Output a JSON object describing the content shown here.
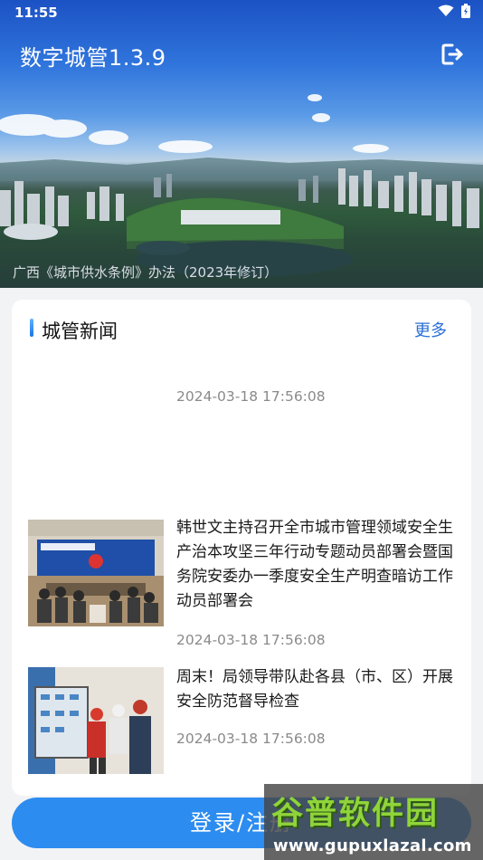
{
  "status_bar": {
    "time": "11:55"
  },
  "header": {
    "title": "数字城管1.3.9"
  },
  "banner": {
    "caption": "广西《城市供水条例》办法（2023年修订）"
  },
  "news": {
    "section_title": "城管新闻",
    "more_label": "更多",
    "items": [
      {
        "title": "",
        "date": "2024-03-18 17:56:08"
      },
      {
        "title": "韩世文主持召开全市城市管理领域安全生产治本攻坚三年行动专题动员部署会暨国务院安委办一季度安全生产明查暗访工作动员部署会",
        "date": "2024-03-18 17:56:08"
      },
      {
        "title": "周末！局领导带队赴各县（市、区）开展安全防范督导检查",
        "date": "2024-03-18 17:56:08"
      }
    ]
  },
  "login": {
    "label": "登录/注册"
  },
  "watermark": {
    "brand": "谷普软件园",
    "url": "www.gupuxlazal.com"
  },
  "colors": {
    "accent": "#2d8cf0",
    "link": "#2a6fd6"
  },
  "icons": [
    "wifi-icon",
    "battery-icon",
    "logout-icon"
  ]
}
